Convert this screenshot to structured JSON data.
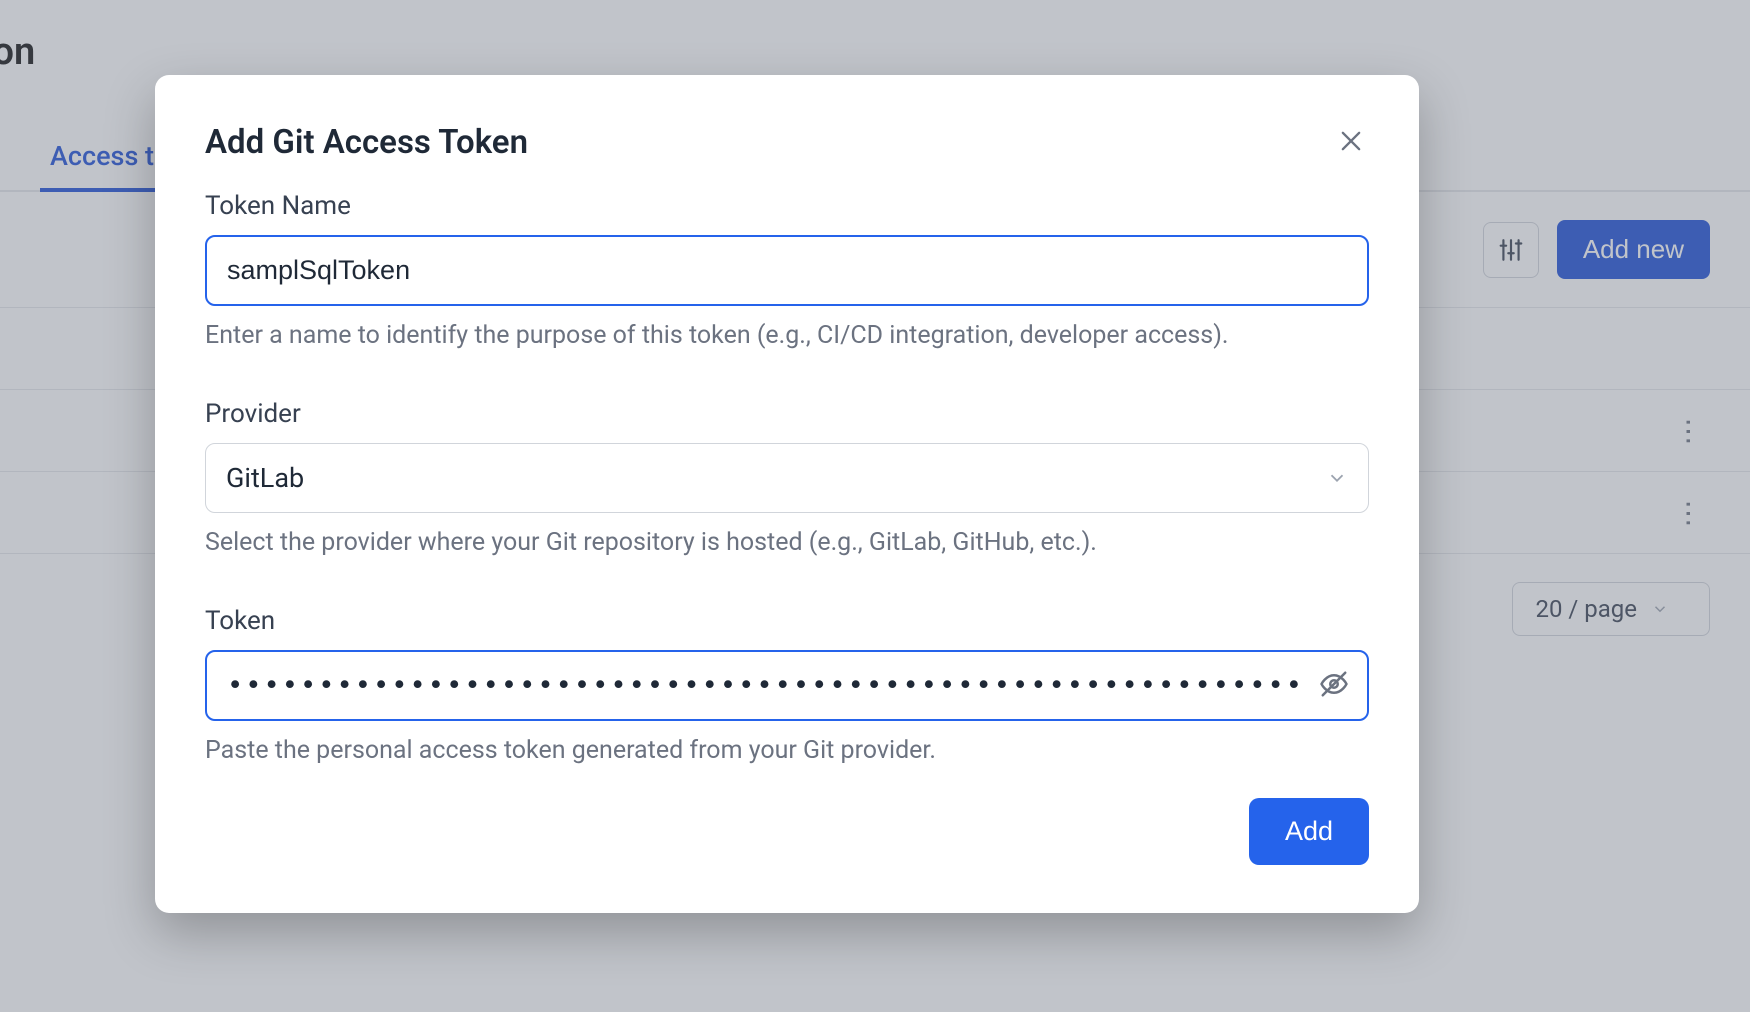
{
  "background": {
    "page_title_fragment": "ition",
    "active_tab_fragment": "Access t",
    "add_new_label": "Add new",
    "page_size_label": "20 / page"
  },
  "modal": {
    "title": "Add Git Access Token",
    "token_name": {
      "label": "Token Name",
      "value": "samplSqlToken",
      "help": "Enter a name to identify the purpose of this token (e.g., CI/CD integration, developer access)."
    },
    "provider": {
      "label": "Provider",
      "selected": "GitLab",
      "help": "Select the provider where your Git repository is hosted (e.g., GitLab, GitHub, etc.)."
    },
    "token": {
      "label": "Token",
      "value_masked": "•••••••••••••••••••••••••••••••••••••••••••••••••••••••••••",
      "help": "Paste the personal access token generated from your Git provider."
    },
    "submit_label": "Add"
  }
}
